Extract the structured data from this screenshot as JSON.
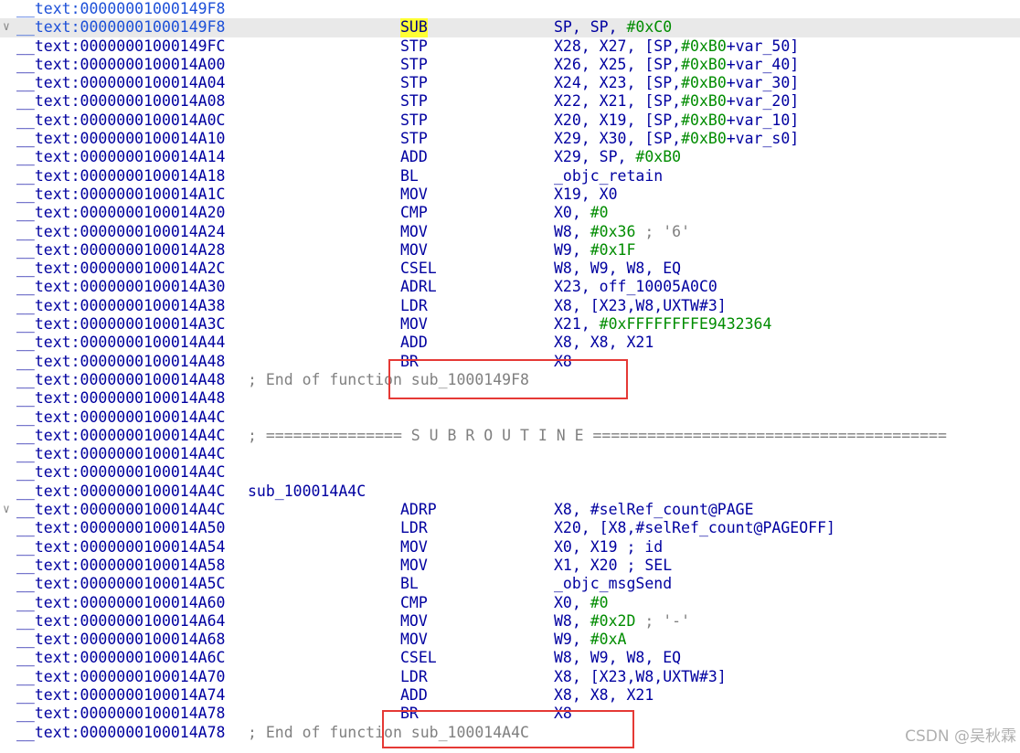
{
  "lines": [
    {
      "seg": "__text:00000001000149F8",
      "kind": "blank",
      "blue": true
    },
    {
      "seg": "__text:00000001000149F8",
      "kind": "insn",
      "mnem": "SUB",
      "ops": [
        [
          "SP, SP, ",
          "t"
        ],
        [
          "#0xC0",
          "n"
        ]
      ],
      "highlight": true,
      "selected": true,
      "fold": true,
      "blue": true
    },
    {
      "seg": "__text:00000001000149FC",
      "kind": "insn",
      "mnem": "STP",
      "ops": [
        [
          "X28, X27, [SP,",
          "t"
        ],
        [
          "#0xB0",
          "n"
        ],
        [
          "+var_50]",
          "t"
        ]
      ]
    },
    {
      "seg": "__text:0000000100014A00",
      "kind": "insn",
      "mnem": "STP",
      "ops": [
        [
          "X26, X25, [SP,",
          "t"
        ],
        [
          "#0xB0",
          "n"
        ],
        [
          "+var_40]",
          "t"
        ]
      ]
    },
    {
      "seg": "__text:0000000100014A04",
      "kind": "insn",
      "mnem": "STP",
      "ops": [
        [
          "X24, X23, [SP,",
          "t"
        ],
        [
          "#0xB0",
          "n"
        ],
        [
          "+var_30]",
          "t"
        ]
      ]
    },
    {
      "seg": "__text:0000000100014A08",
      "kind": "insn",
      "mnem": "STP",
      "ops": [
        [
          "X22, X21, [SP,",
          "t"
        ],
        [
          "#0xB0",
          "n"
        ],
        [
          "+var_20]",
          "t"
        ]
      ]
    },
    {
      "seg": "__text:0000000100014A0C",
      "kind": "insn",
      "mnem": "STP",
      "ops": [
        [
          "X20, X19, [SP,",
          "t"
        ],
        [
          "#0xB0",
          "n"
        ],
        [
          "+var_10]",
          "t"
        ]
      ]
    },
    {
      "seg": "__text:0000000100014A10",
      "kind": "insn",
      "mnem": "STP",
      "ops": [
        [
          "X29, X30, [SP,",
          "t"
        ],
        [
          "#0xB0",
          "n"
        ],
        [
          "+var_s0]",
          "t"
        ]
      ]
    },
    {
      "seg": "__text:0000000100014A14",
      "kind": "insn",
      "mnem": "ADD",
      "ops": [
        [
          "X29, SP, ",
          "t"
        ],
        [
          "#0xB0",
          "n"
        ]
      ]
    },
    {
      "seg": "__text:0000000100014A18",
      "kind": "insn",
      "mnem": "BL",
      "ops": [
        [
          "_objc_retain",
          "t"
        ]
      ]
    },
    {
      "seg": "__text:0000000100014A1C",
      "kind": "insn",
      "mnem": "MOV",
      "ops": [
        [
          "X19, X0",
          "t"
        ]
      ]
    },
    {
      "seg": "__text:0000000100014A20",
      "kind": "insn",
      "mnem": "CMP",
      "ops": [
        [
          "X0, ",
          "t"
        ],
        [
          "#0",
          "n"
        ]
      ]
    },
    {
      "seg": "__text:0000000100014A24",
      "kind": "insn",
      "mnem": "MOV",
      "ops": [
        [
          "W8, ",
          "t"
        ],
        [
          "#0x36",
          "n"
        ],
        [
          " ; '6'",
          "c"
        ]
      ]
    },
    {
      "seg": "__text:0000000100014A28",
      "kind": "insn",
      "mnem": "MOV",
      "ops": [
        [
          "W9, ",
          "t"
        ],
        [
          "#0x1F",
          "n"
        ]
      ]
    },
    {
      "seg": "__text:0000000100014A2C",
      "kind": "insn",
      "mnem": "CSEL",
      "ops": [
        [
          "W8, W9, W8, EQ",
          "t"
        ]
      ]
    },
    {
      "seg": "__text:0000000100014A30",
      "kind": "insn",
      "mnem": "ADRL",
      "ops": [
        [
          "X23, off_10005A0C0",
          "t"
        ]
      ]
    },
    {
      "seg": "__text:0000000100014A38",
      "kind": "insn",
      "mnem": "LDR",
      "ops": [
        [
          "X8, [X23,W8,UXTW#3]",
          "t"
        ]
      ]
    },
    {
      "seg": "__text:0000000100014A3C",
      "kind": "insn",
      "mnem": "MOV",
      "ops": [
        [
          "X21, ",
          "t"
        ],
        [
          "#0xFFFFFFFFE9432364",
          "n"
        ]
      ]
    },
    {
      "seg": "__text:0000000100014A44",
      "kind": "insn",
      "mnem": "ADD",
      "ops": [
        [
          "X8, X8, X21",
          "t"
        ]
      ]
    },
    {
      "seg": "__text:0000000100014A48",
      "kind": "insn",
      "mnem": "BR",
      "ops": [
        [
          "X8",
          "t"
        ]
      ]
    },
    {
      "seg": "__text:0000000100014A48",
      "kind": "comment",
      "text": "; End of function sub_1000149F8"
    },
    {
      "seg": "__text:0000000100014A48",
      "kind": "blank"
    },
    {
      "seg": "__text:0000000100014A4C",
      "kind": "blank"
    },
    {
      "seg": "__text:0000000100014A4C",
      "kind": "comment",
      "text": "; =============== S U B R O U T I N E ======================================="
    },
    {
      "seg": "__text:0000000100014A4C",
      "kind": "blank"
    },
    {
      "seg": "__text:0000000100014A4C",
      "kind": "blank"
    },
    {
      "seg": "__text:0000000100014A4C",
      "kind": "label",
      "text": "sub_100014A4C"
    },
    {
      "seg": "__text:0000000100014A4C",
      "kind": "insn",
      "mnem": "ADRP",
      "ops": [
        [
          "X8, #selRef_count@PAGE",
          "t"
        ]
      ],
      "fold": true
    },
    {
      "seg": "__text:0000000100014A50",
      "kind": "insn",
      "mnem": "LDR",
      "ops": [
        [
          "X20, [X8,#selRef_count@PAGEOFF]",
          "t"
        ]
      ]
    },
    {
      "seg": "__text:0000000100014A54",
      "kind": "insn",
      "mnem": "MOV",
      "ops": [
        [
          "X0, X19 ; id",
          "t"
        ]
      ]
    },
    {
      "seg": "__text:0000000100014A58",
      "kind": "insn",
      "mnem": "MOV",
      "ops": [
        [
          "X1, X20 ; SEL",
          "t"
        ]
      ]
    },
    {
      "seg": "__text:0000000100014A5C",
      "kind": "insn",
      "mnem": "BL",
      "ops": [
        [
          "_objc_msgSend",
          "t"
        ]
      ]
    },
    {
      "seg": "__text:0000000100014A60",
      "kind": "insn",
      "mnem": "CMP",
      "ops": [
        [
          "X0, ",
          "t"
        ],
        [
          "#0",
          "n"
        ]
      ]
    },
    {
      "seg": "__text:0000000100014A64",
      "kind": "insn",
      "mnem": "MOV",
      "ops": [
        [
          "W8, ",
          "t"
        ],
        [
          "#0x2D",
          "n"
        ],
        [
          " ; '-'",
          "c"
        ]
      ]
    },
    {
      "seg": "__text:0000000100014A68",
      "kind": "insn",
      "mnem": "MOV",
      "ops": [
        [
          "W9, ",
          "t"
        ],
        [
          "#0xA",
          "n"
        ]
      ]
    },
    {
      "seg": "__text:0000000100014A6C",
      "kind": "insn",
      "mnem": "CSEL",
      "ops": [
        [
          "W8, W9, W8, EQ",
          "t"
        ]
      ]
    },
    {
      "seg": "__text:0000000100014A70",
      "kind": "insn",
      "mnem": "LDR",
      "ops": [
        [
          "X8, [X23,W8,UXTW#3]",
          "t"
        ]
      ]
    },
    {
      "seg": "__text:0000000100014A74",
      "kind": "insn",
      "mnem": "ADD",
      "ops": [
        [
          "X8, X8, X21",
          "t"
        ]
      ]
    },
    {
      "seg": "__text:0000000100014A78",
      "kind": "insn",
      "mnem": "BR",
      "ops": [
        [
          "X8",
          "t"
        ]
      ]
    },
    {
      "seg": "__text:0000000100014A78",
      "kind": "comment",
      "text": "; End of function sub_100014A4C"
    }
  ],
  "watermark": "CSDN @吴秋霖",
  "colors": {
    "code": "#0000a0",
    "number": "#008c00",
    "comment": "#808080",
    "highlight": "#ffff33",
    "box": "#e53935"
  }
}
